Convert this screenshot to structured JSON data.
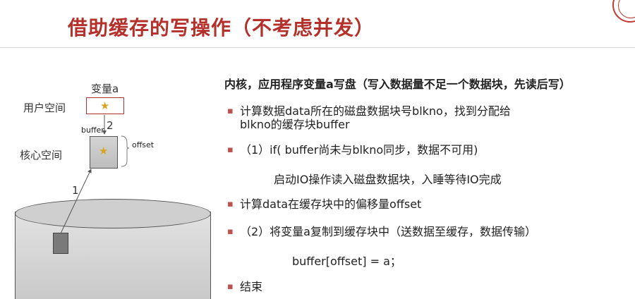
{
  "slide": {
    "title": "借助缓存的写操作（不考虑并发）"
  },
  "diagram": {
    "var_label": "变量a",
    "user_space": "用户空间",
    "kernel_space": "核心空间",
    "buffer_label": "buffer",
    "step2": "2",
    "step1": "1",
    "offset_label": "offset",
    "star_symbol": "★",
    "colors": {
      "star": "#d9a322",
      "accent": "#b4302a"
    }
  },
  "content": {
    "heading": "内核，应用程序变量a写盘（写入数据量不足一个数据块，先读后写）",
    "items": [
      {
        "line1": "计算数据data所在的磁盘数据块号blkno，找到分配给",
        "line2": "blkno的缓存块buffer"
      },
      {
        "line1": "（1）if( buffer尚未与blkno同步，数据不可用)"
      },
      {
        "line1": "启动IO操作读入磁盘数据块，入睡等待IO完成"
      },
      {
        "line1": "计算data在缓存块中的偏移量offset"
      },
      {
        "line1": "（2）将变量a复制到缓存块中（送数据至缓存，数据传输）"
      },
      {
        "line1": "buffer[offset] = a；"
      },
      {
        "line1": "结束"
      }
    ]
  }
}
